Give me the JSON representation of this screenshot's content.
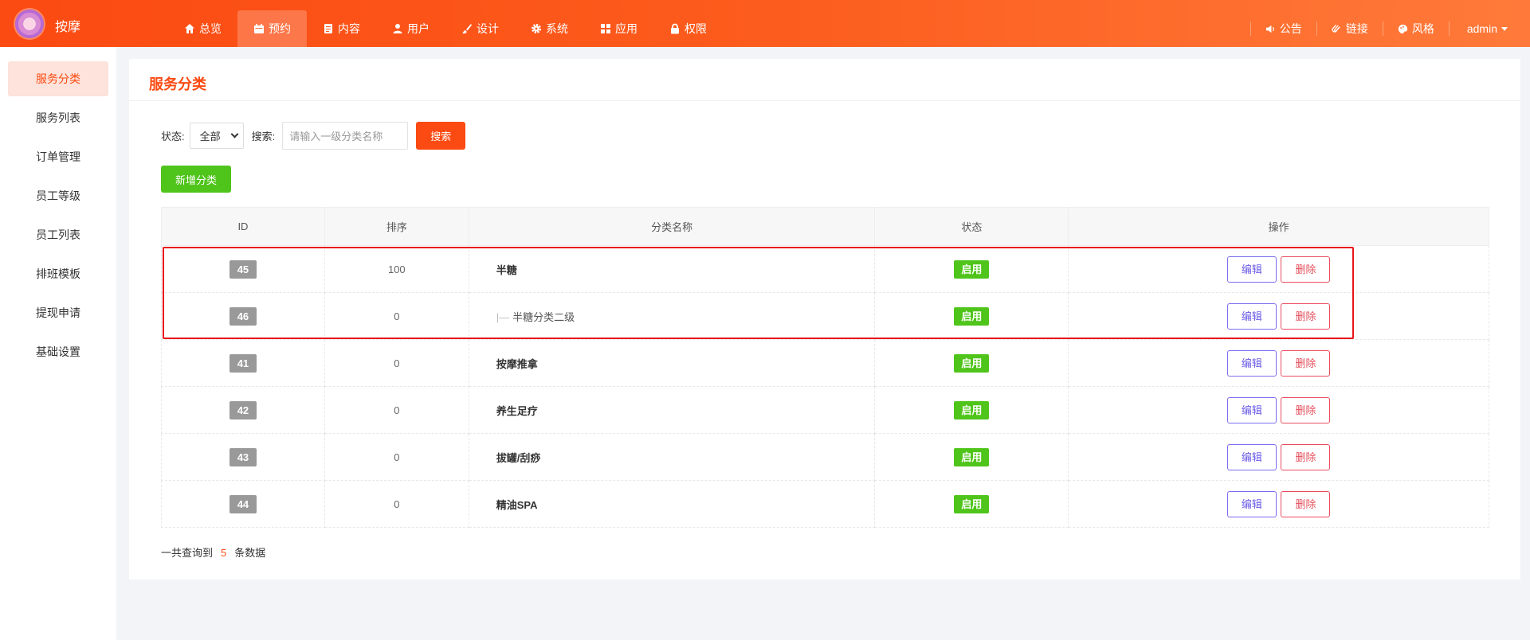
{
  "header": {
    "brand": "按摩",
    "nav": [
      {
        "label": "总览",
        "icon": "home-icon"
      },
      {
        "label": "预约",
        "icon": "calendar-icon"
      },
      {
        "label": "内容",
        "icon": "document-icon"
      },
      {
        "label": "用户",
        "icon": "user-icon"
      },
      {
        "label": "设计",
        "icon": "brush-icon"
      },
      {
        "label": "系统",
        "icon": "gear-icon"
      },
      {
        "label": "应用",
        "icon": "grid-icon"
      },
      {
        "label": "权限",
        "icon": "lock-icon"
      }
    ],
    "right": [
      {
        "label": "公告",
        "icon": "speaker-icon"
      },
      {
        "label": "链接",
        "icon": "link-icon"
      },
      {
        "label": "风格",
        "icon": "palette-icon"
      }
    ],
    "user": "admin"
  },
  "sidebar": {
    "items": [
      {
        "label": "服务分类"
      },
      {
        "label": "服务列表"
      },
      {
        "label": "订单管理"
      },
      {
        "label": "员工等级"
      },
      {
        "label": "员工列表"
      },
      {
        "label": "排班模板"
      },
      {
        "label": "提现申请"
      },
      {
        "label": "基础设置"
      }
    ]
  },
  "main": {
    "title": "服务分类",
    "filter": {
      "status_label": "状态:",
      "status_value": "全部",
      "search_label": "搜索:",
      "search_placeholder": "请输入一级分类名称",
      "search_button": "搜索"
    },
    "add_button": "新增分类",
    "table": {
      "headers": [
        "ID",
        "排序",
        "分类名称",
        "状态",
        "操作"
      ],
      "rows": [
        {
          "id": "45",
          "sort": "100",
          "name": "半糖",
          "status": "启用"
        },
        {
          "id": "46",
          "sort": "0",
          "name": "半糖分类二级",
          "status": "启用",
          "tree_prefix": "|—"
        },
        {
          "id": "41",
          "sort": "0",
          "name": "按摩推拿",
          "status": "启用"
        },
        {
          "id": "42",
          "sort": "0",
          "name": "养生足疗",
          "status": "启用"
        },
        {
          "id": "43",
          "sort": "0",
          "name": "拔罐/刮痧",
          "status": "启用"
        },
        {
          "id": "44",
          "sort": "0",
          "name": "精油SPA",
          "status": "启用"
        }
      ],
      "edit_label": "编辑",
      "delete_label": "删除"
    },
    "total": {
      "prefix": "一共查询到",
      "count": "5",
      "suffix": "条数据"
    }
  },
  "colors": {
    "accent": "#fb4a12",
    "success": "#4fc41a",
    "highlight": "#e8161b"
  }
}
